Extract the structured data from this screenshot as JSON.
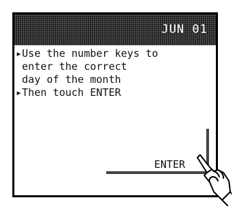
{
  "header": {
    "date": "JUN 01"
  },
  "instructions": {
    "line1": "▸Use the number keys to",
    "line2": " enter the correct",
    "line3": " day of the month",
    "line4": "▸Then touch ENTER"
  },
  "enter_button": {
    "label": "ENTER"
  },
  "icons": {
    "pointer": "pointing-hand-icon"
  }
}
